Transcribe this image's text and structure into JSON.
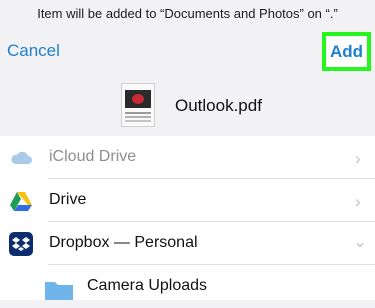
{
  "dialog": {
    "notice": "Item will be added to “Documents and Photos” on “.”",
    "cancel_label": "Cancel",
    "add_label": "Add"
  },
  "file": {
    "name": "Outlook.pdf"
  },
  "locations": [
    {
      "label": "iCloud Drive",
      "icon": "icloud-icon",
      "enabled": false
    },
    {
      "label": "Drive",
      "icon": "google-drive-icon",
      "enabled": true
    },
    {
      "label": "Dropbox — Personal",
      "icon": "dropbox-icon",
      "enabled": true
    },
    {
      "label": "Camera Uploads",
      "icon": "folder-icon",
      "enabled": true
    }
  ],
  "colors": {
    "accent": "#1f7fd0",
    "highlight": "#26f51e"
  }
}
